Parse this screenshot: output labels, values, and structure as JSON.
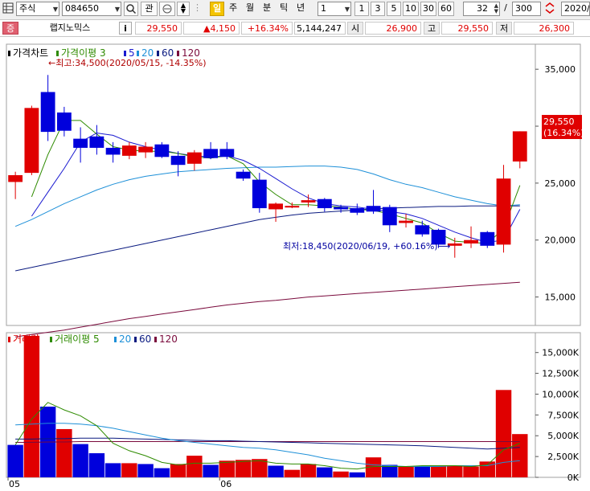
{
  "toolbar": {
    "market": "주식",
    "code": "084650",
    "guan": "관",
    "period_day": "일",
    "period_week": "주",
    "period_month": "월",
    "period_min": "분",
    "period_tick": "틱",
    "period_year": "년",
    "interval": "1",
    "quick": [
      "1",
      "3",
      "5",
      "10",
      "30",
      "60"
    ],
    "count": "32",
    "slash": "/",
    "total": "300",
    "date": "2020/"
  },
  "quote": {
    "badge": "증",
    "name": "랩지노믹스",
    "info": "i",
    "price": "29,550",
    "change": "▲4,150",
    "rate": "+16.34%",
    "volume": "5,144,247",
    "open_label": "시",
    "open": "26,900",
    "high_label": "고",
    "high": "29,550",
    "low_label": "저",
    "low": "26,300"
  },
  "colors": {
    "up": "#e00000",
    "down": "#0000dc",
    "ma3": "#2e8b00",
    "ma5": "#1a1ad0",
    "ma20": "#1e90d8",
    "ma60": "#0a1a80",
    "ma120": "#7a0a3c"
  },
  "chart_data": [
    {
      "type": "candlestick",
      "title": "가격차트",
      "legend": [
        {
          "key": "ma3",
          "label": "가격이평 3"
        },
        {
          "key": "ma5",
          "label": "5"
        },
        {
          "key": "ma20",
          "label": "20"
        },
        {
          "key": "ma60",
          "label": "60"
        },
        {
          "key": "ma120",
          "label": "120"
        }
      ],
      "yticks": [
        15000,
        20000,
        25000,
        30000,
        35000
      ],
      "ytick_labels": [
        "15,000",
        "20,000",
        "25,000",
        "30,000",
        "35,000"
      ],
      "ylim": [
        12500,
        37200
      ],
      "xlabels": [
        {
          "index": 0,
          "label": "05"
        },
        {
          "index": 13,
          "label": "06"
        }
      ],
      "candles": [
        {
          "o": 25100,
          "h": 26000,
          "l": 23600,
          "c": 25700
        },
        {
          "o": 25900,
          "h": 31800,
          "l": 25700,
          "c": 31600
        },
        {
          "o": 33000,
          "h": 34500,
          "l": 28700,
          "c": 29500
        },
        {
          "o": 31200,
          "h": 31700,
          "l": 29100,
          "c": 29600
        },
        {
          "o": 28900,
          "h": 29900,
          "l": 26800,
          "c": 28100
        },
        {
          "o": 29100,
          "h": 30100,
          "l": 27500,
          "c": 28100
        },
        {
          "o": 28100,
          "h": 28600,
          "l": 26800,
          "c": 27500
        },
        {
          "o": 27400,
          "h": 28600,
          "l": 27100,
          "c": 28300
        },
        {
          "o": 27700,
          "h": 28600,
          "l": 27200,
          "c": 28200
        },
        {
          "o": 28400,
          "h": 28600,
          "l": 27200,
          "c": 27300
        },
        {
          "o": 27400,
          "h": 27800,
          "l": 25600,
          "c": 26600
        },
        {
          "o": 26700,
          "h": 27900,
          "l": 26100,
          "c": 27700
        },
        {
          "o": 28000,
          "h": 28600,
          "l": 27100,
          "c": 27200
        },
        {
          "o": 28000,
          "h": 28600,
          "l": 27100,
          "c": 27300
        },
        {
          "o": 26000,
          "h": 26200,
          "l": 25200,
          "c": 25400
        },
        {
          "o": 25300,
          "h": 25900,
          "l": 22400,
          "c": 22800
        },
        {
          "o": 22700,
          "h": 23300,
          "l": 21600,
          "c": 23200
        },
        {
          "o": 23000,
          "h": 23300,
          "l": 22800,
          "c": 23000
        },
        {
          "o": 23300,
          "h": 24000,
          "l": 22900,
          "c": 23500
        },
        {
          "o": 23600,
          "h": 23700,
          "l": 22500,
          "c": 22800
        },
        {
          "o": 22900,
          "h": 23100,
          "l": 22400,
          "c": 22700
        },
        {
          "o": 22800,
          "h": 23200,
          "l": 22200,
          "c": 22400
        },
        {
          "o": 23000,
          "h": 24400,
          "l": 22300,
          "c": 22500
        },
        {
          "o": 22900,
          "h": 23100,
          "l": 20700,
          "c": 21300
        },
        {
          "o": 21500,
          "h": 22300,
          "l": 21100,
          "c": 21700
        },
        {
          "o": 21300,
          "h": 21700,
          "l": 20300,
          "c": 20500
        },
        {
          "o": 20900,
          "h": 21000,
          "l": 19300,
          "c": 19600
        },
        {
          "o": 19500,
          "h": 20200,
          "l": 18450,
          "c": 19700
        },
        {
          "o": 19700,
          "h": 21200,
          "l": 19300,
          "c": 20000
        },
        {
          "o": 20700,
          "h": 20800,
          "l": 19300,
          "c": 19500
        },
        {
          "o": 19600,
          "h": 26600,
          "l": 18900,
          "c": 25400
        },
        {
          "o": 26900,
          "h": 29550,
          "l": 26300,
          "c": 29550
        }
      ],
      "ma": {
        "ma3": [
          null,
          23800,
          27500,
          30500,
          30500,
          29300,
          28200,
          27900,
          27800,
          27800,
          27600,
          27300,
          27200,
          27400,
          26700,
          25100,
          24000,
          23100,
          23100,
          23000,
          22900,
          22700,
          22600,
          22300,
          21900,
          21500,
          20600,
          19900,
          19800,
          19700,
          21000,
          24800
        ],
        "ma5": [
          null,
          22100,
          24200,
          26300,
          28600,
          29400,
          29200,
          28600,
          28200,
          27900,
          27600,
          27400,
          27300,
          27400,
          27000,
          26300,
          25400,
          24500,
          23700,
          23200,
          23000,
          22900,
          22700,
          22500,
          22300,
          21900,
          21300,
          20700,
          20200,
          19800,
          20000,
          22700
        ],
        "ma20": [
          21200,
          21800,
          22500,
          23200,
          23800,
          24400,
          24900,
          25300,
          25600,
          25800,
          26000,
          26100,
          26200,
          26300,
          26350,
          26400,
          26400,
          26450,
          26500,
          26500,
          26400,
          26200,
          25800,
          25300,
          24900,
          24600,
          24200,
          23800,
          23500,
          23200,
          23000,
          23100
        ],
        "ma60": [
          17300,
          17600,
          17900,
          18200,
          18500,
          18800,
          19100,
          19400,
          19700,
          20000,
          20300,
          20600,
          20900,
          21200,
          21500,
          21800,
          22000,
          22200,
          22350,
          22450,
          22550,
          22650,
          22750,
          22800,
          22850,
          22900,
          22950,
          22950,
          23000,
          23000,
          23000,
          23000
        ],
        "ma120": [
          11500,
          11700,
          11900,
          12100,
          12350,
          12600,
          12850,
          13100,
          13300,
          13500,
          13700,
          13900,
          14100,
          14300,
          14450,
          14600,
          14700,
          14850,
          15000,
          15100,
          15200,
          15300,
          15400,
          15500,
          15600,
          15700,
          15800,
          15900,
          16000,
          16100,
          16200,
          16300
        ]
      },
      "annotations": {
        "high": "←최고:34,500(2020/05/15, -14.35%)",
        "low": "최저:18,450(2020/06/19, +60.16%)⟶",
        "price_tag": "29,550",
        "price_tag_rate": "(16.34%)"
      }
    },
    {
      "type": "bar",
      "title": "거래량",
      "legend": [
        {
          "key": "ma5",
          "label": "거래이평 5"
        },
        {
          "key": "ma20",
          "label": "20"
        },
        {
          "key": "ma60",
          "label": "60"
        },
        {
          "key": "ma120",
          "label": "120"
        }
      ],
      "yticks": [
        0,
        2500000,
        5000000,
        7500000,
        10000000,
        12500000,
        15000000
      ],
      "ytick_labels": [
        "0K",
        "2,500K",
        "5,000K",
        "7,500K",
        "10,000K",
        "12,500K",
        "15,000K"
      ],
      "ylim": [
        0,
        17000000
      ],
      "values": [
        3900000,
        17000000,
        8500000,
        5800000,
        4000000,
        2900000,
        1700000,
        1700000,
        1600000,
        1100000,
        1600000,
        2600000,
        1500000,
        2000000,
        2100000,
        2200000,
        1400000,
        900000,
        1600000,
        1200000,
        700000,
        600000,
        2400000,
        1500000,
        1300000,
        1400000,
        1300000,
        1400000,
        1300000,
        1900000,
        10500000,
        5200000
      ],
      "up": [
        false,
        true,
        false,
        true,
        false,
        false,
        false,
        true,
        false,
        false,
        true,
        true,
        false,
        true,
        true,
        true,
        false,
        true,
        true,
        false,
        true,
        false,
        true,
        false,
        true,
        false,
        true,
        true,
        true,
        true,
        true,
        true
      ],
      "ma": {
        "ma5": [
          3900000,
          7000000,
          9000000,
          8100000,
          7400000,
          6200000,
          4100000,
          3200000,
          2600000,
          1800000,
          1500000,
          1700000,
          1700000,
          1800000,
          1900000,
          2000000,
          1700000,
          1600000,
          1600000,
          1400000,
          1100000,
          1000000,
          1300000,
          1300000,
          1300000,
          1400000,
          1400000,
          1400000,
          1300000,
          1500000,
          3300000,
          4100000
        ],
        "ma20": [
          6300000,
          6400000,
          6500000,
          6500000,
          6400000,
          6200000,
          5900000,
          5500000,
          5100000,
          4700000,
          4400000,
          4200000,
          4000000,
          3800000,
          3600000,
          3500000,
          3300000,
          3000000,
          2700000,
          2300000,
          2000000,
          1700000,
          1500000,
          1400000,
          1300000,
          1300000,
          1300000,
          1400000,
          1400000,
          1400000,
          1800000,
          2000000
        ],
        "ma60": [
          4600000,
          4600000,
          4650000,
          4650000,
          4700000,
          4700000,
          4700000,
          4650000,
          4600000,
          4550000,
          4500000,
          4450000,
          4400000,
          4400000,
          4350000,
          4300000,
          4250000,
          4200000,
          4150000,
          4100000,
          4050000,
          4000000,
          3950000,
          3900000,
          3850000,
          3800000,
          3700000,
          3600000,
          3500000,
          3400000,
          3500000,
          3600000
        ],
        "ma120": [
          4200000,
          4200000,
          4250000,
          4250000,
          4300000,
          4300000,
          4300000,
          4300000,
          4300000,
          4300000,
          4300000,
          4300000,
          4300000,
          4300000,
          4300000,
          4300000,
          4300000,
          4300000,
          4300000,
          4300000,
          4300000,
          4300000,
          4300000,
          4300000,
          4300000,
          4300000,
          4300000,
          4300000,
          4300000,
          4300000,
          4300000,
          4300000
        ]
      }
    }
  ]
}
